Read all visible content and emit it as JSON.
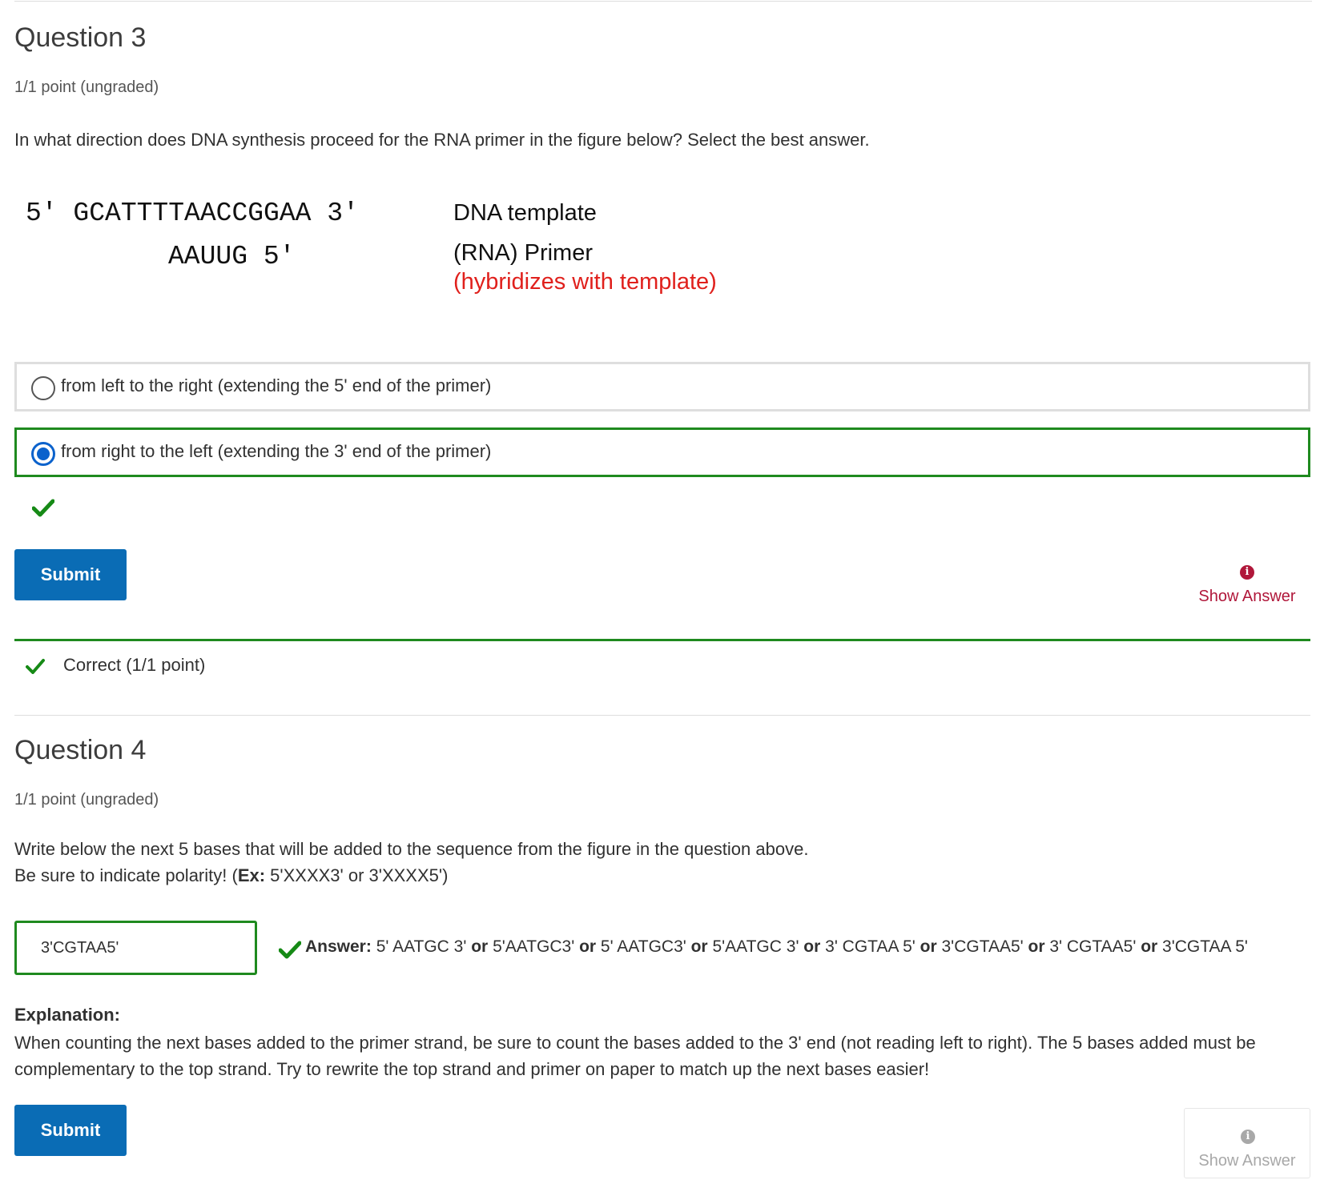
{
  "q3": {
    "title": "Question 3",
    "points": "1/1 point (ungraded)",
    "prompt": "In what direction does DNA synthesis proceed for the RNA primer in the figure below? Select the best answer.",
    "figure": {
      "template_seq": "5′ GCATTTTAACCGGAA 3′",
      "primer_seq": "AAUUG 5′",
      "template_label": "DNA template",
      "primer_label": "(RNA) Primer",
      "primer_note": "(hybridizes with template)"
    },
    "choices": [
      {
        "label": "from left to the right (extending the 5' end of the primer)",
        "selected": false
      },
      {
        "label": "from right to the left (extending the 3' end of the primer)",
        "selected": true
      }
    ],
    "submit_label": "Submit",
    "show_answer_label": "Show Answer",
    "result_text": "Correct (1/1 point)"
  },
  "q4": {
    "title": "Question 4",
    "points": "1/1 point (ungraded)",
    "prompt_line1": "Write below the next 5 bases that will be added to the sequence from the figure in the question above.",
    "prompt_line2_prefix": "Be sure to indicate polarity! (",
    "prompt_line2_bold": "Ex:",
    "prompt_line2_suffix": " 5'XXXX3' or 3'XXXX5')",
    "input_value": "3'CGTAA5'",
    "answer_label": "Answer:",
    "answers": [
      "5' AATGC 3'",
      "5'AATGC3'",
      "5' AATGC3'",
      "5'AATGC 3'",
      "3' CGTAA 5'",
      "3'CGTAA5'",
      "3' CGTAA5'",
      "3'CGTAA 5'"
    ],
    "or_word": "or",
    "explanation_title": "Explanation:",
    "explanation_body": "When counting the next bases added to the primer strand, be sure to count the bases added to the 3' end (not reading left to right). The 5 bases added must be complementary to the top strand. Try to rewrite the top strand and primer on paper to match up the next bases easier!",
    "submit_label": "Submit",
    "show_answer_label": "Show Answer"
  },
  "colors": {
    "accent_blue": "#0a6cb5",
    "correct_green": "#1f8a1f",
    "show_answer_red": "#b0173a",
    "disabled_gray": "#a8a8a8"
  },
  "icons": {
    "check": "check-icon",
    "info": "info-icon",
    "radio": "radio-button"
  }
}
